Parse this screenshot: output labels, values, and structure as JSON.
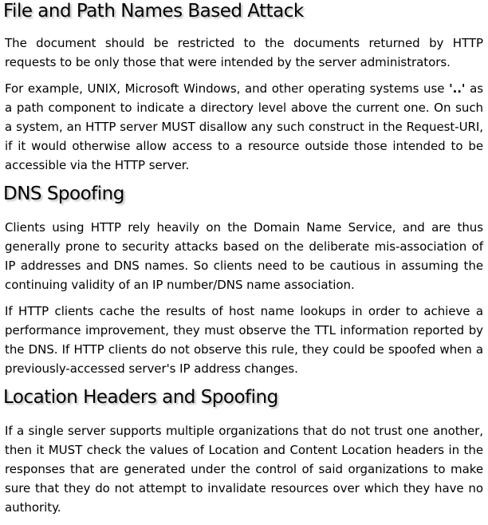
{
  "sections": [
    {
      "title": "File and Path Names Based Attack",
      "paragraphs": [
        "The document should be restricted to the documents returned by HTTP requests to be only those that were intended by the server administrators.",
        {
          "before": "For example, UNIX, Microsoft Windows, and other operating systems use ",
          "emphasis": "'..'",
          "after": " as a path component to indicate a directory level above the current one. On such a system, an HTTP server MUST disallow any such construct in the Request-URI, if it would otherwise allow access to a resource outside those intended to be accessible via the HTTP server."
        }
      ]
    },
    {
      "title": "DNS Spoofing",
      "paragraphs": [
        "Clients using HTTP rely heavily on the Domain Name Service, and are thus generally prone to security attacks based on the deliberate mis-association of IP addresses and DNS names. So clients need to be cautious in assuming the continuing validity of an IP number/DNS name association.",
        "If HTTP clients cache the results of host name lookups in order to achieve a performance improvement, they must observe the TTL information reported by the DNS. If HTTP clients do not observe this rule, they could be spoofed when a previously-accessed server's IP address changes."
      ]
    },
    {
      "title": "Location Headers and Spoofing",
      "paragraphs": [
        "If a single server supports multiple organizations that do not trust one another, then it MUST check the values of Location and Content Location headers in the responses that are generated under the control of said organizations to make sure that they do not attempt to invalidate resources over which they have no authority."
      ]
    }
  ]
}
